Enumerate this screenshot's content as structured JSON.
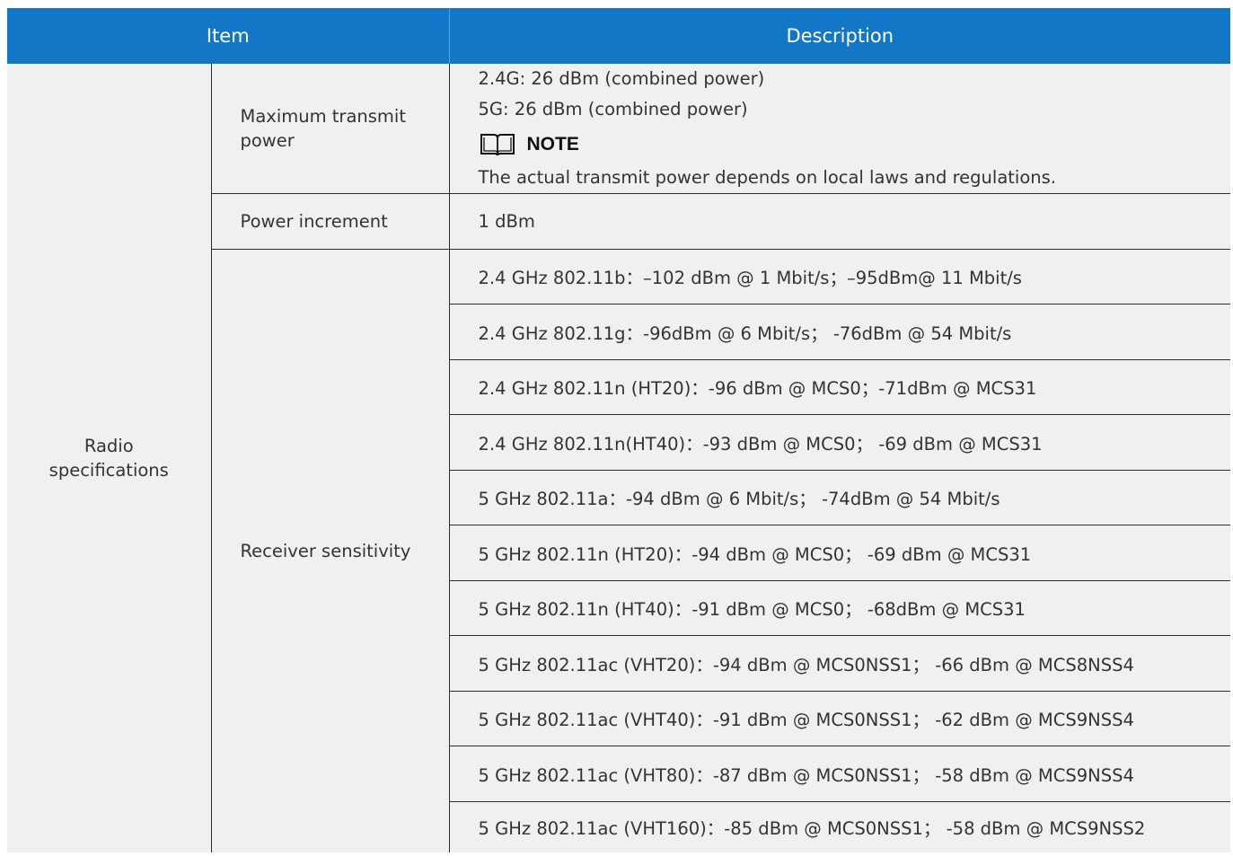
{
  "header": {
    "item": "Item",
    "description": "Description"
  },
  "category": {
    "line1": "Radio",
    "line2": "specifications"
  },
  "max_power": {
    "label": "Maximum transmit power",
    "line_24g": "2.4G: 26 dBm (combined power)",
    "line_5g": "5G: 26 dBm (combined power)",
    "note_icon": "book-icon",
    "note_label": "NOTE",
    "note_text": "The actual transmit power depends on local laws and regulations."
  },
  "power_increment": {
    "label": "Power increment",
    "value": "1 dBm"
  },
  "receiver_sensitivity": {
    "label": "Receiver sensitivity",
    "rows": [
      "2.4 GHz  802.11b：–102 dBm @ 1 Mbit/s；–95dBm@ 11 Mbit/s",
      "2.4 GHz  802.11g：-96dBm @ 6 Mbit/s； -76dBm @ 54 Mbit/s",
      "2.4 GHz  802.11n (HT20)：-96 dBm @ MCS0；-71dBm @ MCS31",
      "2.4 GHz  802.11n(HT40)：-93 dBm @ MCS0；  -69 dBm @ MCS31",
      "5 GHz  802.11a：-94 dBm @ 6 Mbit/s；  -74dBm @ 54 Mbit/s",
      "5 GHz  802.11n (HT20)：-94 dBm @ MCS0；  -69 dBm @ MCS31",
      "5 GHz  802.11n (HT40)：-91 dBm @ MCS0；  -68dBm @ MCS31",
      "5 GHz  802.11ac (VHT20)：-94 dBm @ MCS0NSS1；  -66 dBm @ MCS8NSS4",
      "5 GHz  802.11ac (VHT40)：-91 dBm @ MCS0NSS1；  -62 dBm @ MCS9NSS4",
      "5 GHz  802.11ac (VHT80)：-87 dBm @ MCS0NSS1；  -58 dBm @ MCS9NSS4",
      "5 GHz  802.11ac (VHT160)：-85 dBm @ MCS0NSS1；  -58 dBm @ MCS9NSS2"
    ]
  },
  "colors": {
    "header_bg": "#1277c6",
    "header_text": "#ffffff",
    "cell_bg": "#f0f0f0",
    "border": "#2b2b2b"
  }
}
